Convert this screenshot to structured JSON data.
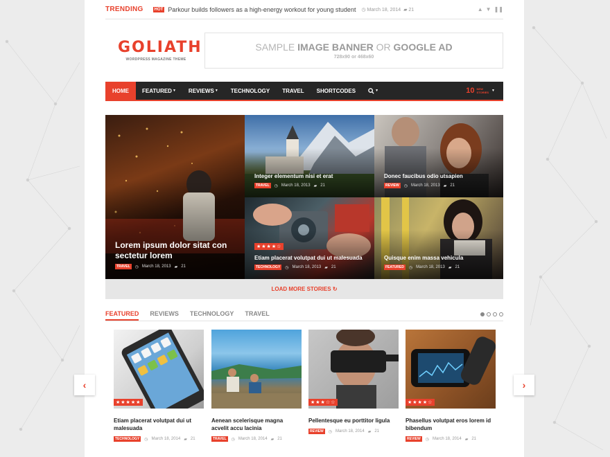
{
  "trending": {
    "label": "TRENDING",
    "hot": "HOT",
    "headline": "Parkour builds followers as a high-energy workout for young student",
    "date": "March 18, 2014",
    "comments": "21"
  },
  "logo": {
    "name": "GOLIATH",
    "tagline": "WORDPRESS MAGAZINE THEME"
  },
  "banner": {
    "line1_a": "SAMPLE ",
    "line1_b": "IMAGE BANNER",
    "line1_c": " OR ",
    "line1_d": "GOOGLE AD",
    "line2": "728x90 or 468x60"
  },
  "nav": {
    "items": [
      {
        "label": "HOME",
        "active": true,
        "caret": false
      },
      {
        "label": "FEATURED",
        "caret": true
      },
      {
        "label": "REVIEWS",
        "caret": true
      },
      {
        "label": "TECHNOLOGY",
        "caret": false
      },
      {
        "label": "TRAVEL",
        "caret": false
      },
      {
        "label": "SHORTCODES",
        "caret": false
      }
    ],
    "new_count": "10",
    "new_label_1": "NEW",
    "new_label_2": "STORIES"
  },
  "hero": [
    {
      "title": "Lorem ipsum dolor sitat con sectetur lorem",
      "category": "TRAVEL",
      "date": "March 18, 2013",
      "comments": "21"
    },
    {
      "title": "Integer elementum nisi et erat",
      "category": "TRAVEL",
      "date": "March 18, 2013",
      "comments": "21"
    },
    {
      "title": "Donec faucibus odio utsapien",
      "category": "REVIEW",
      "date": "March 18, 2013",
      "comments": "21"
    },
    {
      "title": "Etiam placerat volutpat dui ut malesuada",
      "category": "TECHNOLOGY",
      "date": "March 18, 2013",
      "comments": "21",
      "rating": 4
    },
    {
      "title": "Quisque enim massa vehicula",
      "category": "FEATURED",
      "date": "March 18, 2013",
      "comments": "21"
    }
  ],
  "load_more": "LOAD MORE STORIES",
  "tabs": [
    "FEATURED",
    "REVIEWS",
    "TECHNOLOGY",
    "TRAVEL"
  ],
  "cards": [
    {
      "title": "Etiam placerat volutpat dui ut malesuada",
      "category": "TECHNOLOGY",
      "date": "March 18, 2014",
      "comments": "21",
      "rating": 5
    },
    {
      "title": "Aenean scelerisque magna acvelit accu lacinia",
      "category": "TRAVEL",
      "date": "March 18, 2014",
      "comments": "21"
    },
    {
      "title": "Pellentesque eu porttitor ligula",
      "category": "REVIEW",
      "date": "March 18, 2014",
      "comments": "21",
      "rating": 3
    },
    {
      "title": "Phasellus volutpat eros lorem id bibendum",
      "category": "REVIEW",
      "date": "March 18, 2014",
      "comments": "21",
      "rating": 4
    }
  ],
  "colors": {
    "accent": "#e8412c",
    "nav_bg": "#262626"
  },
  "icons": {
    "clock": "clock-icon",
    "comment": "comment-icon",
    "search": "search-icon",
    "refresh": "refresh-icon"
  }
}
